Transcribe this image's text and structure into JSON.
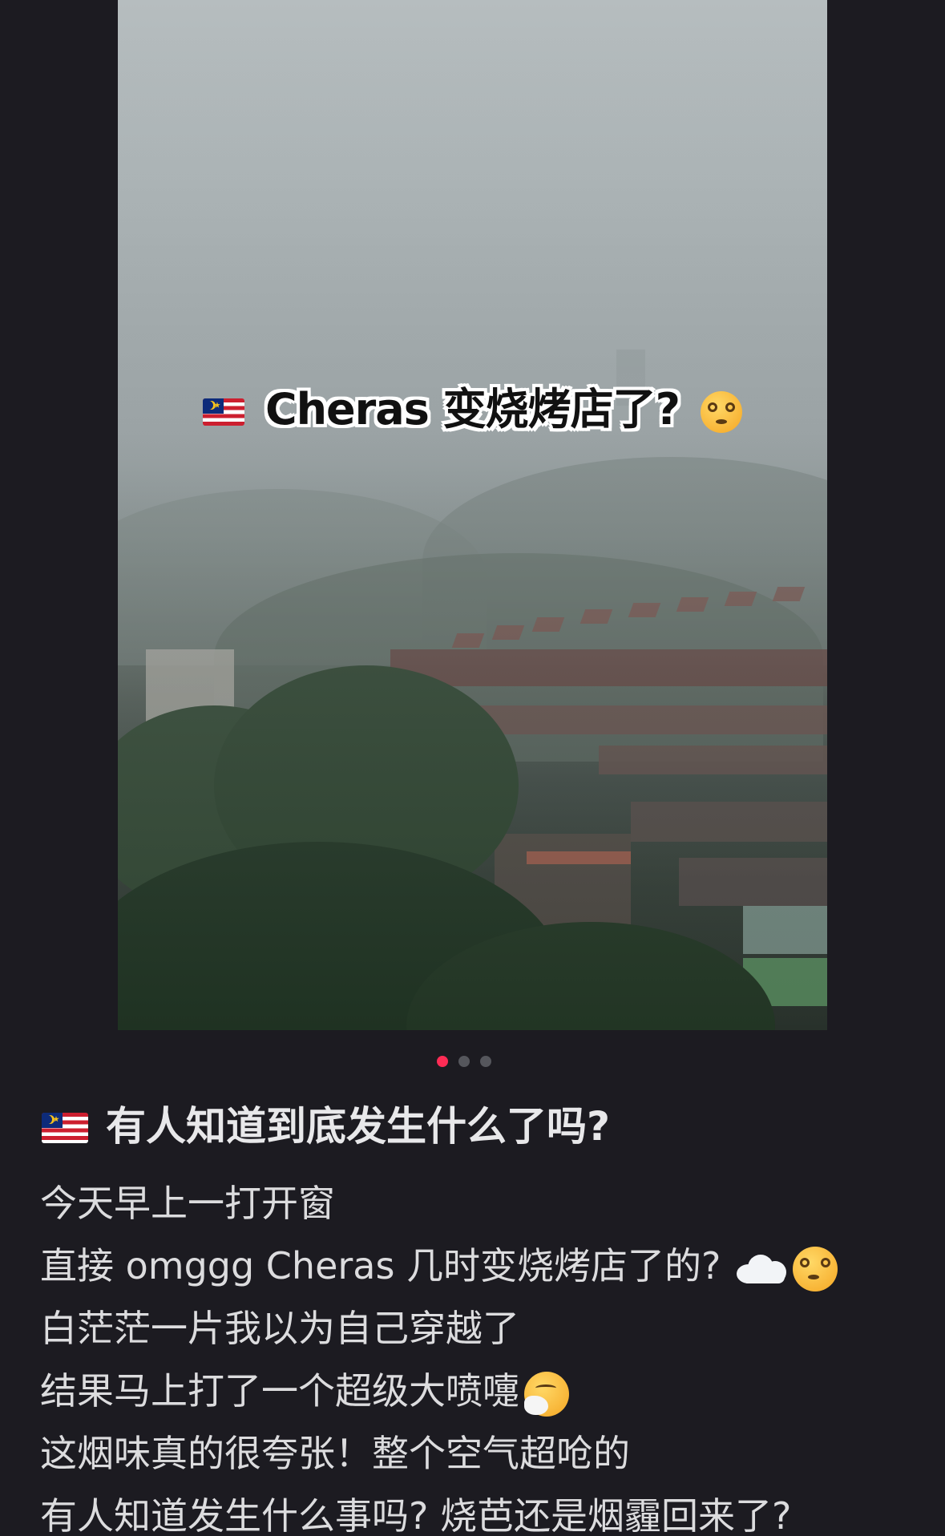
{
  "photo": {
    "overlay_title": "Cheras 变烧烤店了?",
    "flag_icon": "malaysia-flag-icon",
    "emoji_icon": "dizzy-face-icon"
  },
  "carousel": {
    "total": 3,
    "active_index": 0,
    "active_color": "#fe2c55"
  },
  "post": {
    "title": "有人知道到底发生什么了吗?",
    "lines": [
      "今天早上一打开窗",
      "直接 omggg Cheras 几时变烧烤店了的?",
      "白茫茫一片我以为自己穿越了",
      "结果马上打了一个超级大喷嚏",
      "这烟味真的很夸张！整个空气超呛的",
      "有人知道发生什么事吗? 烧芭还是烟霾回来了?"
    ]
  },
  "colors": {
    "background": "#1c1b21",
    "text": "#dcdcde"
  }
}
